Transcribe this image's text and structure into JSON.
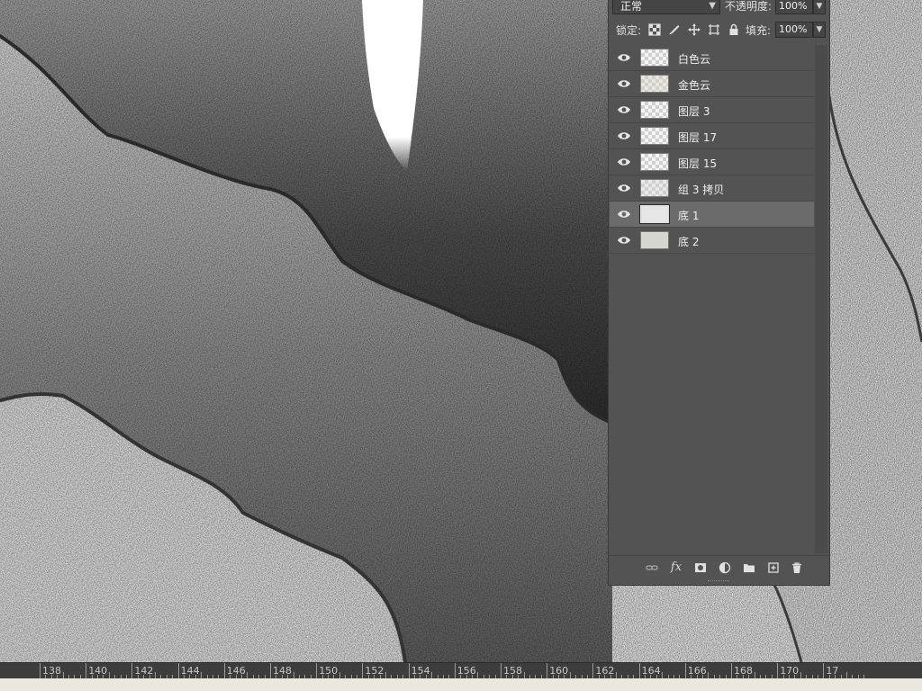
{
  "blend_mode": "正常",
  "opacity_label": "不透明度:",
  "opacity_value": "100%",
  "lock_label": "锁定:",
  "fill_label": "填充:",
  "fill_value": "100%",
  "layers": [
    {
      "name": "白色云",
      "thumb": "transparent",
      "selected": false
    },
    {
      "name": "金色云",
      "thumb": "gold",
      "selected": false
    },
    {
      "name": "图层 3",
      "thumb": "transparent",
      "selected": false
    },
    {
      "name": "图层 17",
      "thumb": "transparent",
      "selected": false
    },
    {
      "name": "图层 15",
      "thumb": "transparent",
      "selected": false
    },
    {
      "name": "组 3 拷贝",
      "thumb": "transparent",
      "selected": false
    },
    {
      "name": "底 1",
      "thumb": "solid-light",
      "selected": true
    },
    {
      "name": "底 2",
      "thumb": "solid-sage",
      "selected": false
    }
  ],
  "bottom_icons": [
    "link-icon",
    "fx-icon",
    "mask-icon",
    "adjustment-icon",
    "folder-icon",
    "new-layer-icon",
    "trash-icon"
  ],
  "fx_label": "fx",
  "ruler": {
    "labels": [
      "138",
      "140",
      "142",
      "144",
      "146",
      "148",
      "150",
      "152",
      "154",
      "156",
      "158",
      "160",
      "162",
      "164",
      "166",
      "168",
      "170",
      "17"
    ]
  },
  "colors": {
    "panel_bg": "#535353",
    "selected_row": "#6b6b6b",
    "ruler_bg": "#3d3d3d"
  }
}
